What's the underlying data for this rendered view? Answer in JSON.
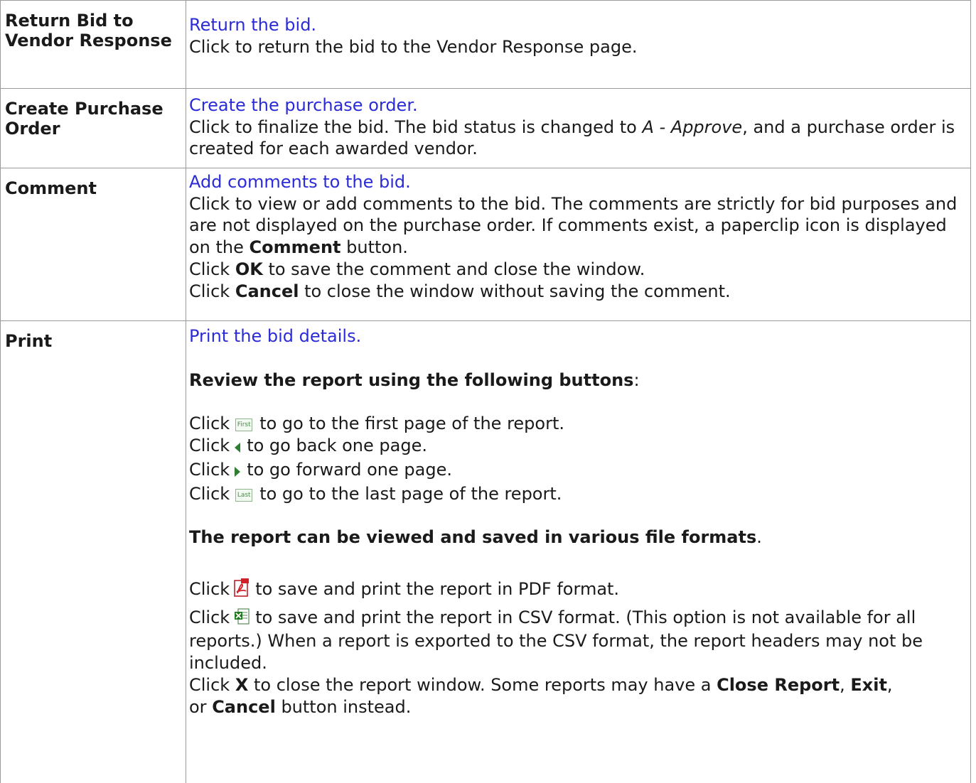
{
  "rows": [
    {
      "label": "Return Bid to Vendor Response",
      "link": "Return the bid.",
      "desc": "Click to return the bid to the Vendor Response page."
    },
    {
      "label": "Create Purchase Order",
      "link": "Create the purchase order.",
      "desc_pre": "Click to finalize the bid. The bid status is changed to ",
      "desc_italic": "A - Approve",
      "desc_post": ", and a purchase order is created for each awarded vendor."
    },
    {
      "label": "Comment",
      "link": "Add comments to the bid.",
      "desc1_pre": "Click to view or add comments to the bid. The comments are strictly for bid purposes and are not displayed on the purchase order. If comments exist, a paperclip icon is displayed on the ",
      "desc1_bold": "Comment",
      "desc1_post": " button.",
      "ok_click": "Click ",
      "ok_bold": "OK",
      "ok_post": " to save the comment and close the window.",
      "cancel_click": "Click ",
      "cancel_bold": "Cancel",
      "cancel_post": " to close the window without saving the comment."
    },
    {
      "label": "Print",
      "link": "Print the bid details.",
      "review_bold": "Review the report using the following buttons",
      "review_post": ":",
      "nav": [
        {
          "pre": "Click",
          "icon": "first-page-icon",
          "icon_text": "First",
          "post": "to go to the first page of the report."
        },
        {
          "pre": "Click",
          "icon": "previous-page-icon",
          "post": "to go back one page."
        },
        {
          "pre": "Click",
          "icon": "next-page-icon",
          "post": "to go forward one page."
        },
        {
          "pre": "Click",
          "icon": "last-page-icon",
          "icon_text": "Last",
          "post": "to go to the last page of the report."
        }
      ],
      "formats_bold": "The report can be viewed and saved in various file formats",
      "formats_post": ".",
      "pdf_pre": "Click",
      "pdf_post": "to save and print the report in PDF format.",
      "csv_pre": "Click",
      "csv_post": "to save and print the report in CSV format. (This option is not available for all reports.) When a report is exported to the CSV format, the report headers may not be included.",
      "x_pre": "Click ",
      "x_bold": "X",
      "x_mid": " to close the report window. Some reports may have a ",
      "close_bold": "Close Report",
      "comma1": ", ",
      "exit_bold": "Exit",
      "comma2": ",",
      "or_text": "or ",
      "cancel_bold": "Cancel",
      "x_post": " button instead."
    }
  ],
  "colors": {
    "link": "#2b2bd8",
    "border": "#9a9a9a"
  }
}
